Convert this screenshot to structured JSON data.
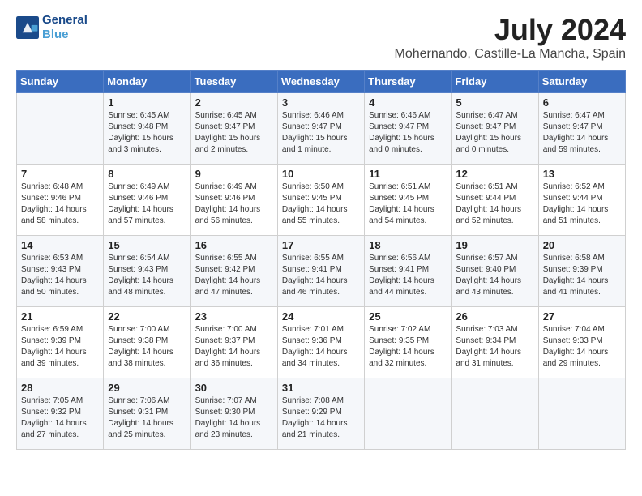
{
  "header": {
    "logo_line1": "General",
    "logo_line2": "Blue",
    "month": "July 2024",
    "location": "Mohernando, Castille-La Mancha, Spain"
  },
  "days_of_week": [
    "Sunday",
    "Monday",
    "Tuesday",
    "Wednesday",
    "Thursday",
    "Friday",
    "Saturday"
  ],
  "weeks": [
    [
      {
        "day": "",
        "sunrise": "",
        "sunset": "",
        "daylight": ""
      },
      {
        "day": "1",
        "sunrise": "6:45 AM",
        "sunset": "9:48 PM",
        "daylight": "15 hours and 3 minutes."
      },
      {
        "day": "2",
        "sunrise": "6:45 AM",
        "sunset": "9:47 PM",
        "daylight": "15 hours and 2 minutes."
      },
      {
        "day": "3",
        "sunrise": "6:46 AM",
        "sunset": "9:47 PM",
        "daylight": "15 hours and 1 minute."
      },
      {
        "day": "4",
        "sunrise": "6:46 AM",
        "sunset": "9:47 PM",
        "daylight": "15 hours and 0 minutes."
      },
      {
        "day": "5",
        "sunrise": "6:47 AM",
        "sunset": "9:47 PM",
        "daylight": "15 hours and 0 minutes."
      },
      {
        "day": "6",
        "sunrise": "6:47 AM",
        "sunset": "9:47 PM",
        "daylight": "14 hours and 59 minutes."
      }
    ],
    [
      {
        "day": "7",
        "sunrise": "6:48 AM",
        "sunset": "9:46 PM",
        "daylight": "14 hours and 58 minutes."
      },
      {
        "day": "8",
        "sunrise": "6:49 AM",
        "sunset": "9:46 PM",
        "daylight": "14 hours and 57 minutes."
      },
      {
        "day": "9",
        "sunrise": "6:49 AM",
        "sunset": "9:46 PM",
        "daylight": "14 hours and 56 minutes."
      },
      {
        "day": "10",
        "sunrise": "6:50 AM",
        "sunset": "9:45 PM",
        "daylight": "14 hours and 55 minutes."
      },
      {
        "day": "11",
        "sunrise": "6:51 AM",
        "sunset": "9:45 PM",
        "daylight": "14 hours and 54 minutes."
      },
      {
        "day": "12",
        "sunrise": "6:51 AM",
        "sunset": "9:44 PM",
        "daylight": "14 hours and 52 minutes."
      },
      {
        "day": "13",
        "sunrise": "6:52 AM",
        "sunset": "9:44 PM",
        "daylight": "14 hours and 51 minutes."
      }
    ],
    [
      {
        "day": "14",
        "sunrise": "6:53 AM",
        "sunset": "9:43 PM",
        "daylight": "14 hours and 50 minutes."
      },
      {
        "day": "15",
        "sunrise": "6:54 AM",
        "sunset": "9:43 PM",
        "daylight": "14 hours and 48 minutes."
      },
      {
        "day": "16",
        "sunrise": "6:55 AM",
        "sunset": "9:42 PM",
        "daylight": "14 hours and 47 minutes."
      },
      {
        "day": "17",
        "sunrise": "6:55 AM",
        "sunset": "9:41 PM",
        "daylight": "14 hours and 46 minutes."
      },
      {
        "day": "18",
        "sunrise": "6:56 AM",
        "sunset": "9:41 PM",
        "daylight": "14 hours and 44 minutes."
      },
      {
        "day": "19",
        "sunrise": "6:57 AM",
        "sunset": "9:40 PM",
        "daylight": "14 hours and 43 minutes."
      },
      {
        "day": "20",
        "sunrise": "6:58 AM",
        "sunset": "9:39 PM",
        "daylight": "14 hours and 41 minutes."
      }
    ],
    [
      {
        "day": "21",
        "sunrise": "6:59 AM",
        "sunset": "9:39 PM",
        "daylight": "14 hours and 39 minutes."
      },
      {
        "day": "22",
        "sunrise": "7:00 AM",
        "sunset": "9:38 PM",
        "daylight": "14 hours and 38 minutes."
      },
      {
        "day": "23",
        "sunrise": "7:00 AM",
        "sunset": "9:37 PM",
        "daylight": "14 hours and 36 minutes."
      },
      {
        "day": "24",
        "sunrise": "7:01 AM",
        "sunset": "9:36 PM",
        "daylight": "14 hours and 34 minutes."
      },
      {
        "day": "25",
        "sunrise": "7:02 AM",
        "sunset": "9:35 PM",
        "daylight": "14 hours and 32 minutes."
      },
      {
        "day": "26",
        "sunrise": "7:03 AM",
        "sunset": "9:34 PM",
        "daylight": "14 hours and 31 minutes."
      },
      {
        "day": "27",
        "sunrise": "7:04 AM",
        "sunset": "9:33 PM",
        "daylight": "14 hours and 29 minutes."
      }
    ],
    [
      {
        "day": "28",
        "sunrise": "7:05 AM",
        "sunset": "9:32 PM",
        "daylight": "14 hours and 27 minutes."
      },
      {
        "day": "29",
        "sunrise": "7:06 AM",
        "sunset": "9:31 PM",
        "daylight": "14 hours and 25 minutes."
      },
      {
        "day": "30",
        "sunrise": "7:07 AM",
        "sunset": "9:30 PM",
        "daylight": "14 hours and 23 minutes."
      },
      {
        "day": "31",
        "sunrise": "7:08 AM",
        "sunset": "9:29 PM",
        "daylight": "14 hours and 21 minutes."
      },
      {
        "day": "",
        "sunrise": "",
        "sunset": "",
        "daylight": ""
      },
      {
        "day": "",
        "sunrise": "",
        "sunset": "",
        "daylight": ""
      },
      {
        "day": "",
        "sunrise": "",
        "sunset": "",
        "daylight": ""
      }
    ]
  ]
}
